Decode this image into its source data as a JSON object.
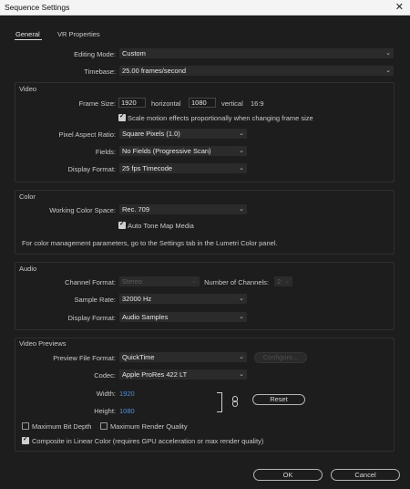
{
  "window": {
    "title": "Sequence Settings",
    "close_glyph": "✕"
  },
  "tabs": {
    "general": "General",
    "vr": "VR Properties"
  },
  "top": {
    "editing_mode_label": "Editing Mode:",
    "editing_mode_value": "Custom",
    "timebase_label": "Timebase:",
    "timebase_value": "25.00  frames/second"
  },
  "video": {
    "title": "Video",
    "frame_size_label": "Frame Size:",
    "width": "1920",
    "horizontal": "horizontal",
    "height": "1080",
    "vertical": "vertical",
    "aspect": "16:9",
    "scale_motion": "Scale motion effects proportionally when changing frame size",
    "par_label": "Pixel Aspect Ratio:",
    "par_value": "Square Pixels (1.0)",
    "fields_label": "Fields:",
    "fields_value": "No Fields (Progressive Scan)",
    "display_label": "Display Format:",
    "display_value": "25 fps Timecode"
  },
  "color": {
    "title": "Color",
    "wcs_label": "Working Color Space:",
    "wcs_value": "Rec. 709",
    "auto_tone": "Auto Tone Map Media",
    "note": "For color management parameters, go to the Settings tab in the Lumetri Color panel."
  },
  "audio": {
    "title": "Audio",
    "channel_label": "Channel Format:",
    "channel_value": "Stereo",
    "num_channels_label": "Number of Channels:",
    "num_channels_value": "2",
    "sample_label": "Sample Rate:",
    "sample_value": "32000 Hz",
    "display_label": "Display Format:",
    "display_value": "Audio Samples"
  },
  "previews": {
    "title": "Video Previews",
    "format_label": "Preview File Format:",
    "format_value": "QuickTime",
    "configure": "Configure...",
    "codec_label": "Codec:",
    "codec_value": "Apple ProRes 422 LT",
    "width_label": "Width:",
    "width_value": "1920",
    "height_label": "Height:",
    "height_value": "1080",
    "reset": "Reset",
    "max_bit_depth": "Maximum Bit Depth",
    "max_render": "Maximum Render Quality",
    "composite": "Composite in Linear Color (requires GPU acceleration or max render quality)"
  },
  "footer": {
    "ok": "OK",
    "cancel": "Cancel"
  },
  "colors": {
    "accent_blue": "#4a90e2",
    "background": "#1d1d1d"
  }
}
